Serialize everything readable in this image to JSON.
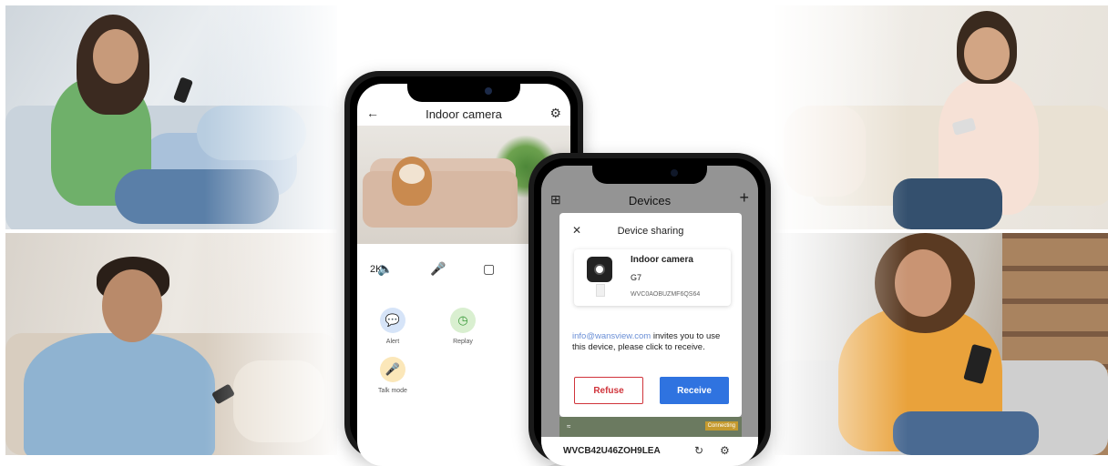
{
  "colors": {
    "accent_blue": "#2f73e0",
    "refuse_red": "#d0343b",
    "alert_blue": "#d6e4f8",
    "replay_green": "#d9efd0",
    "talk_yellow": "#fbe7b9"
  },
  "phone_camera": {
    "header_title": "Indoor camera",
    "back_icon": "arrow-left-icon",
    "settings_icon": "gear-icon",
    "quality_badge": "2K",
    "controls": [
      "speaker-icon",
      "microphone-icon",
      "record-icon"
    ],
    "functions": [
      {
        "label": "Alert",
        "icon": "chat-bubble-icon"
      },
      {
        "label": "Replay",
        "icon": "replay-clock-icon"
      },
      {
        "label": "Talk mode",
        "icon": "microphone-icon"
      }
    ]
  },
  "phone_devices": {
    "header_title": "Devices",
    "grid_icon": "grid-icon",
    "add_icon": "plus-icon",
    "dialog": {
      "title": "Device sharing",
      "close_icon": "close-icon",
      "device_name": "Indoor camera",
      "device_model": "G7",
      "device_id": "WVC0AOBUZMF6QS64",
      "invite_email": "info@wansview.com",
      "invite_text": "invites you to use this device, please click to receive.",
      "refuse_label": "Refuse",
      "receive_label": "Receive"
    },
    "list_item": {
      "connecting_label": "Connecting",
      "device_code": "WVCB42U46ZOH9LEA"
    }
  }
}
